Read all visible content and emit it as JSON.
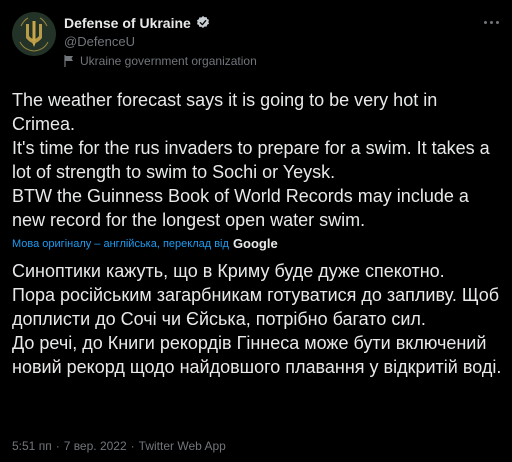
{
  "author": {
    "display_name": "Defense of Ukraine",
    "handle": "@DefenceU",
    "affiliation": "Ukraine government organization"
  },
  "tweet": {
    "text": "The weather forecast says it is going to be very hot in Crimea.\nIt's time for the rus invaders to prepare for a swim. It takes a lot of strength to swim to Sochi or Yeysk.\nBTW the Guinness Book of World Records may include a new record for the longest open water swim.",
    "translation_note": "Мова оригіналу – англійська, переклад від",
    "translation_provider": "Google",
    "translated_text": "Синоптики кажуть, що в Криму буде дуже спекотно.\nПора російським загарбникам готуватися до запливу. Щоб доплисти до Сочі чи Єйська, потрібно багато сил.\nДо речі, до Книги рекордів Гіннеса може бути включений новий рекорд щодо найдовшого плавання у відкритій воді."
  },
  "meta": {
    "time": "5:51 пп",
    "date": "7 вер. 2022",
    "client": "Twitter Web App",
    "separator": "·"
  },
  "icons": {
    "avatar": "ukraine-trident-emblem",
    "verified": "verified-badge-icon",
    "affiliation": "flag-icon",
    "more": "more-options-icon"
  },
  "colors": {
    "background": "#000000",
    "text": "#e7e9ea",
    "muted": "#71767b",
    "link": "#1d9bf0"
  }
}
